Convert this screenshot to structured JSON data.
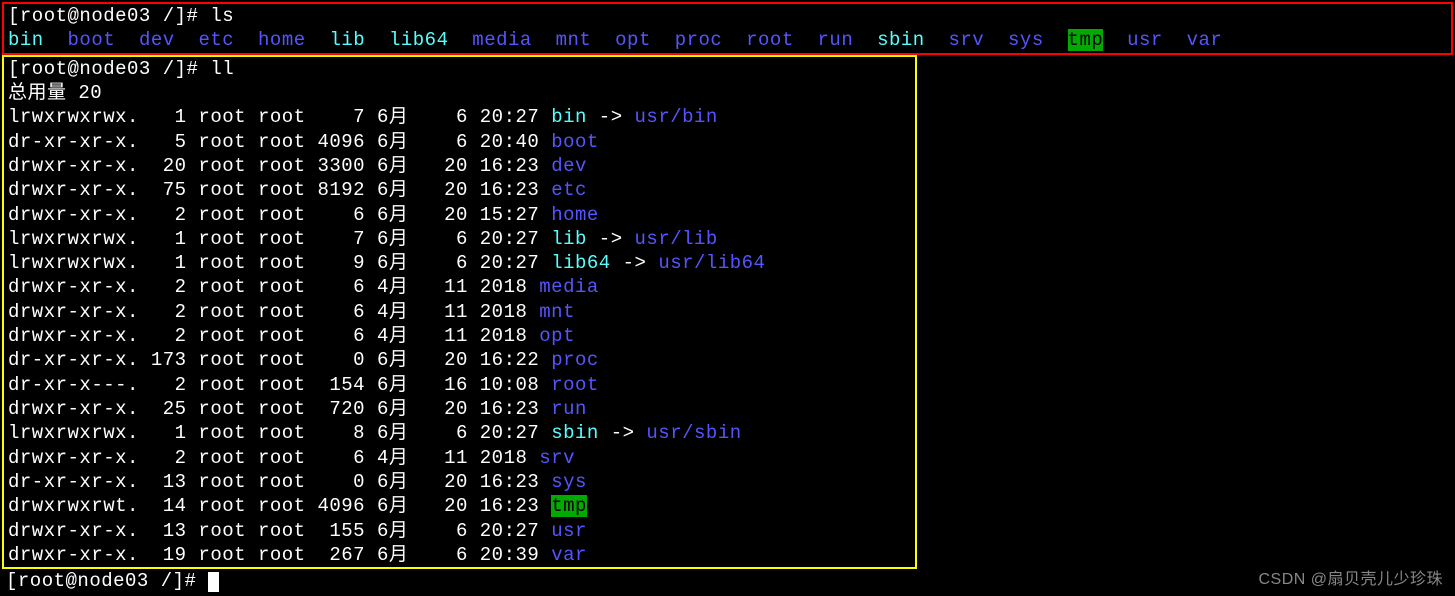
{
  "prompt1": "[root@node03 /]# ls",
  "ls_items": [
    {
      "name": "bin",
      "cls": "link-cyan"
    },
    {
      "name": "boot",
      "cls": "dir-blue"
    },
    {
      "name": "dev",
      "cls": "dir-blue"
    },
    {
      "name": "etc",
      "cls": "dir-blue"
    },
    {
      "name": "home",
      "cls": "dir-blue"
    },
    {
      "name": "lib",
      "cls": "link-cyan"
    },
    {
      "name": "lib64",
      "cls": "link-cyan"
    },
    {
      "name": "media",
      "cls": "dir-blue"
    },
    {
      "name": "mnt",
      "cls": "dir-blue"
    },
    {
      "name": "opt",
      "cls": "dir-blue"
    },
    {
      "name": "proc",
      "cls": "dir-blue"
    },
    {
      "name": "root",
      "cls": "dir-blue"
    },
    {
      "name": "run",
      "cls": "dir-blue"
    },
    {
      "name": "sbin",
      "cls": "link-cyan"
    },
    {
      "name": "srv",
      "cls": "dir-blue"
    },
    {
      "name": "sys",
      "cls": "dir-blue"
    },
    {
      "name": "tmp",
      "cls": "tmp-green"
    },
    {
      "name": "usr",
      "cls": "dir-blue"
    },
    {
      "name": "var",
      "cls": "dir-blue"
    }
  ],
  "prompt2": "[root@node03 /]# ll",
  "total_line": "总用量 20",
  "ll_rows": [
    {
      "perm": "lrwxrwxrwx.",
      "links": "1",
      "owner": "root",
      "group": "root",
      "size": "7",
      "month": "6月",
      "day": "6",
      "time": "20:27",
      "name": "bin",
      "ncls": "link-cyan",
      "arrow": " -> ",
      "target": "usr/bin",
      "tcls": "dir-blue"
    },
    {
      "perm": "dr-xr-xr-x.",
      "links": "5",
      "owner": "root",
      "group": "root",
      "size": "4096",
      "month": "6月",
      "day": "6",
      "time": "20:40",
      "name": "boot",
      "ncls": "dir-blue"
    },
    {
      "perm": "drwxr-xr-x.",
      "links": "20",
      "owner": "root",
      "group": "root",
      "size": "3300",
      "month": "6月",
      "day": "20",
      "time": "16:23",
      "name": "dev",
      "ncls": "dir-blue"
    },
    {
      "perm": "drwxr-xr-x.",
      "links": "75",
      "owner": "root",
      "group": "root",
      "size": "8192",
      "month": "6月",
      "day": "20",
      "time": "16:23",
      "name": "etc",
      "ncls": "dir-blue"
    },
    {
      "perm": "drwxr-xr-x.",
      "links": "2",
      "owner": "root",
      "group": "root",
      "size": "6",
      "month": "6月",
      "day": "20",
      "time": "15:27",
      "name": "home",
      "ncls": "dir-blue"
    },
    {
      "perm": "lrwxrwxrwx.",
      "links": "1",
      "owner": "root",
      "group": "root",
      "size": "7",
      "month": "6月",
      "day": "6",
      "time": "20:27",
      "name": "lib",
      "ncls": "link-cyan",
      "arrow": " -> ",
      "target": "usr/lib",
      "tcls": "dir-blue"
    },
    {
      "perm": "lrwxrwxrwx.",
      "links": "1",
      "owner": "root",
      "group": "root",
      "size": "9",
      "month": "6月",
      "day": "6",
      "time": "20:27",
      "name": "lib64",
      "ncls": "link-cyan",
      "arrow": " -> ",
      "target": "usr/lib64",
      "tcls": "dir-blue"
    },
    {
      "perm": "drwxr-xr-x.",
      "links": "2",
      "owner": "root",
      "group": "root",
      "size": "6",
      "month": "4月",
      "day": "11",
      "time": "2018",
      "name": "media",
      "ncls": "dir-blue"
    },
    {
      "perm": "drwxr-xr-x.",
      "links": "2",
      "owner": "root",
      "group": "root",
      "size": "6",
      "month": "4月",
      "day": "11",
      "time": "2018",
      "name": "mnt",
      "ncls": "dir-blue"
    },
    {
      "perm": "drwxr-xr-x.",
      "links": "2",
      "owner": "root",
      "group": "root",
      "size": "6",
      "month": "4月",
      "day": "11",
      "time": "2018",
      "name": "opt",
      "ncls": "dir-blue"
    },
    {
      "perm": "dr-xr-xr-x.",
      "links": "173",
      "owner": "root",
      "group": "root",
      "size": "0",
      "month": "6月",
      "day": "20",
      "time": "16:22",
      "name": "proc",
      "ncls": "dir-blue"
    },
    {
      "perm": "dr-xr-x---.",
      "links": "2",
      "owner": "root",
      "group": "root",
      "size": "154",
      "month": "6月",
      "day": "16",
      "time": "10:08",
      "name": "root",
      "ncls": "dir-blue"
    },
    {
      "perm": "drwxr-xr-x.",
      "links": "25",
      "owner": "root",
      "group": "root",
      "size": "720",
      "month": "6月",
      "day": "20",
      "time": "16:23",
      "name": "run",
      "ncls": "dir-blue"
    },
    {
      "perm": "lrwxrwxrwx.",
      "links": "1",
      "owner": "root",
      "group": "root",
      "size": "8",
      "month": "6月",
      "day": "6",
      "time": "20:27",
      "name": "sbin",
      "ncls": "link-cyan",
      "arrow": " -> ",
      "target": "usr/sbin",
      "tcls": "dir-blue"
    },
    {
      "perm": "drwxr-xr-x.",
      "links": "2",
      "owner": "root",
      "group": "root",
      "size": "6",
      "month": "4月",
      "day": "11",
      "time": "2018",
      "name": "srv",
      "ncls": "dir-blue"
    },
    {
      "perm": "dr-xr-xr-x.",
      "links": "13",
      "owner": "root",
      "group": "root",
      "size": "0",
      "month": "6月",
      "day": "20",
      "time": "16:23",
      "name": "sys",
      "ncls": "dir-blue"
    },
    {
      "perm": "drwxrwxrwt.",
      "links": "14",
      "owner": "root",
      "group": "root",
      "size": "4096",
      "month": "6月",
      "day": "20",
      "time": "16:23",
      "name": "tmp",
      "ncls": "tmp-green"
    },
    {
      "perm": "drwxr-xr-x.",
      "links": "13",
      "owner": "root",
      "group": "root",
      "size": "155",
      "month": "6月",
      "day": "6",
      "time": "20:27",
      "name": "usr",
      "ncls": "dir-blue"
    },
    {
      "perm": "drwxr-xr-x.",
      "links": "19",
      "owner": "root",
      "group": "root",
      "size": "267",
      "month": "6月",
      "day": "6",
      "time": "20:39",
      "name": "var",
      "ncls": "dir-blue"
    }
  ],
  "prompt3": "[root@node03 /]# ",
  "watermark": "CSDN @扇贝壳儿少珍珠"
}
